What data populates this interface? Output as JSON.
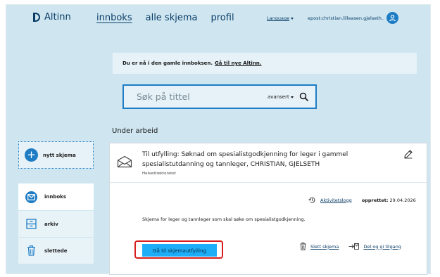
{
  "header": {
    "logo_text": "Altinn",
    "nav": [
      {
        "label": "innboks",
        "active": true
      },
      {
        "label": "alle skjema",
        "active": false
      },
      {
        "label": "profil",
        "active": false
      }
    ],
    "language_label": "Language",
    "user_email": "epost:christian.lilleasen.gjelseth...",
    "user_icon": "user-icon"
  },
  "notice": {
    "text": "Du er nå i den gamle innboksen.",
    "link": "Gå til nye Altinn."
  },
  "search": {
    "placeholder": "Søk på tittel",
    "advanced_label": "avansert",
    "icon": "search-icon"
  },
  "sidebar": {
    "new_form_label": "nytt skjema",
    "items": [
      {
        "label": "innboks",
        "icon": "inbox-icon",
        "active": true
      },
      {
        "label": "arkiv",
        "icon": "archive-icon",
        "active": false
      },
      {
        "label": "slettede",
        "icon": "trash-icon",
        "active": false
      }
    ]
  },
  "main": {
    "section_title": "Under arbeid",
    "card": {
      "title": "Til utfylling: Søknad om spesialistgodkjenning for leger i gammel spesialistutdanning og tannleger, CHRISTIAN, GJELSETH",
      "org": "Helsedirektoratet",
      "activity_log_label": "Aktivitetslogg",
      "created_label": "opprettet:",
      "created_date": "29.04.2026",
      "description": "Skjema for leger og tannleger som skal søke om spesialistgodkjenning.",
      "primary_button": "Gå til skjemautfylling",
      "delete_label": "Slett skjema",
      "share_label": "Del og gi tilgang"
    }
  },
  "colors": {
    "page_bg": "#cfe6f1",
    "accent": "#1d7cc4",
    "primary_button": "#1eadf7",
    "highlight_outline": "#d81e1e",
    "text_dark": "#0a3d66"
  }
}
